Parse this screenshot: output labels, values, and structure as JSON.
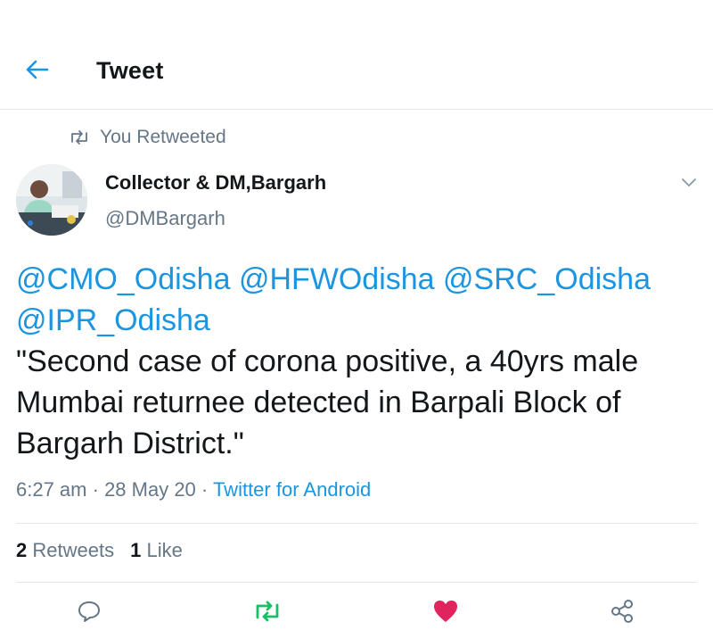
{
  "header": {
    "title": "Tweet",
    "back_icon": "arrow-left-icon"
  },
  "retweet_banner": {
    "text": "You Retweeted",
    "icon": "retweet-icon"
  },
  "author": {
    "name": "Collector & DM,Bargarh",
    "handle": "@DMBargarh"
  },
  "tweet": {
    "mentions": [
      "@CMO_Odisha",
      "@HFWOdisha",
      "@SRC_Odisha",
      "@IPR_Odisha"
    ],
    "body": "\"Second case of corona positive, a 40yrs male Mumbai returnee detected in Barpali Block of Bargarh District.\""
  },
  "meta": {
    "time": "6:27 am",
    "sep1": " · ",
    "date": "28 May 20",
    "sep2": " · ",
    "source": "Twitter for Android"
  },
  "stats": {
    "retweets_count": "2",
    "retweets_label": "Retweets",
    "likes_count": "1",
    "likes_label": "Like"
  },
  "actions": {
    "reply_icon": "reply-icon",
    "retweet_icon": "retweet-icon",
    "like_icon": "heart-icon",
    "share_icon": "share-icon"
  },
  "colors": {
    "accent": "#1b95e0",
    "retweet_active": "#17bf63",
    "like_active": "#e0245e",
    "muted": "#657786"
  }
}
